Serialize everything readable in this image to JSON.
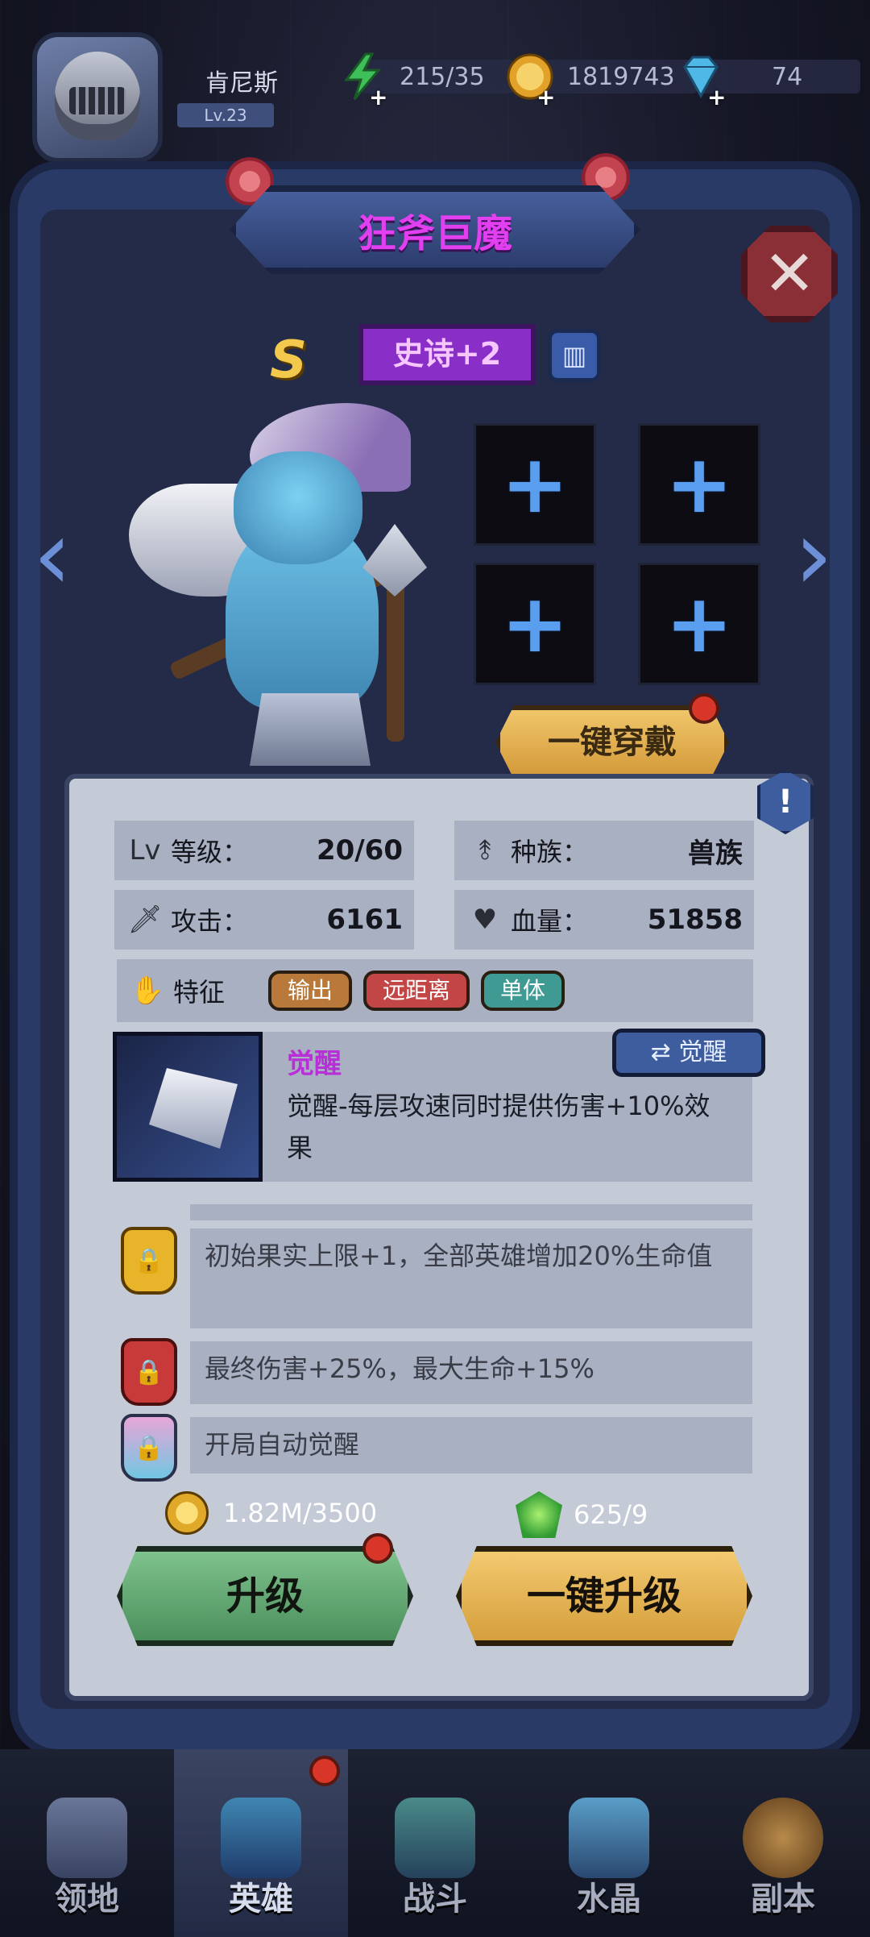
{
  "player": {
    "name": "肯尼斯",
    "level": "Lv.23"
  },
  "resources": {
    "stamina": "215/35",
    "coins": "1819743",
    "gems": "74"
  },
  "hero": {
    "name": "狂斧巨魔",
    "grade": "S",
    "rarity": "史诗+2",
    "equip_button": "一键穿戴",
    "stats": {
      "level_label": "等级：",
      "level_value": "20/60",
      "race_label": "种族：",
      "race_value": "兽族",
      "attack_label": "攻击：",
      "attack_value": "6161",
      "hp_label": "血量：",
      "hp_value": "51858"
    },
    "traits": {
      "label": "特征",
      "tags": [
        "输出",
        "远距离",
        "单体"
      ]
    },
    "skill": {
      "title": "觉醒",
      "awaken_button": "觉醒",
      "description": "觉醒-每层攻速同时提供伤害+10%效果"
    },
    "perks": [
      "初始果实上限+1，全部英雄增加20%生命值",
      "最终伤害+25%，最大生命+15%",
      "开局自动觉醒"
    ],
    "cost": {
      "gold": "1.82M/3500",
      "gem": "625/9"
    },
    "upgrade_button": "升级",
    "one_click_upgrade_button": "一键升级"
  },
  "nav": [
    {
      "label": "领地"
    },
    {
      "label": "英雄"
    },
    {
      "label": "战斗"
    },
    {
      "label": "水晶"
    },
    {
      "label": "副本"
    }
  ],
  "colors": {
    "title": "#e23ff0",
    "rarity_bg": "#8a2ec8",
    "upgrade_green": "#6bb27c",
    "gold_button": "#e6b355",
    "accent_blue": "#5a9ef0"
  },
  "icons": [
    "helmet-avatar-icon",
    "lightning-icon",
    "coin-icon",
    "diamond-icon",
    "close-icon",
    "book-icon",
    "info-icon",
    "plus-icon",
    "sword-icon",
    "heart-icon",
    "dna-icon",
    "claw-icon",
    "lock-icon",
    "gem-icon"
  ]
}
